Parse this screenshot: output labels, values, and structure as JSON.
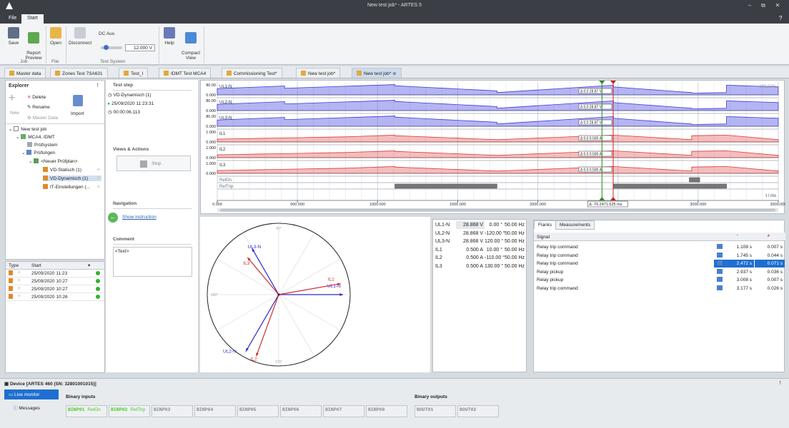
{
  "window": {
    "title": "New test job* - ARTES 5",
    "controls": [
      "–",
      "⧉",
      "✕"
    ]
  },
  "menu": {
    "file": "File",
    "start": "Start"
  },
  "ribbon": {
    "save": "Save",
    "report_preview": "Report\nPreview",
    "open": "Open",
    "disconnect": "Disconnect",
    "dc_aux": "DC Aux.",
    "dc_value": "12.000 V",
    "help": "Help",
    "compact_view": "Compact\nView",
    "group_job": "Job",
    "group_file": "File",
    "group_test_system": "Test System"
  },
  "doc_tabs": [
    "Master data",
    "Zones Test 7SA631",
    "Test_I",
    "IDMT Test MCA4",
    "Commissioning Test*",
    "New test job*",
    "New test job*"
  ],
  "explorer": {
    "title": "Explorer",
    "actions": {
      "new": "New",
      "delete": "Delete",
      "rename": "Rename",
      "import": "Import",
      "master_data": "Master Data"
    },
    "tree": [
      "New test job",
      "MCA4, IDMT",
      "Prüfsystem",
      "Prüfungen",
      "<Neuer Prüfplan>",
      "VD-Statisch (1)",
      "VD-Dynamisch (1)",
      "IT-Einstellungen (..."
    ]
  },
  "history": {
    "col_type": "Type",
    "col_start": "Start",
    "rows": [
      "25/09/2020 11:23",
      "25/09/2020 10:27",
      "25/09/2020 10:27",
      "25/09/2020 10:26"
    ]
  },
  "test_step": {
    "title": "Test step",
    "name": "VD-Dynamisch (1)",
    "date": "25/09/2020 11:23:31",
    "duration": "00:00:06.113",
    "views_title": "Views & Actions",
    "stop": "Stop",
    "nav_title": "Navigation",
    "show_instruction": "Show instruction",
    "comment_title": "Comment",
    "comment": "<Text>"
  },
  "chart_data": {
    "type": "line",
    "xlabel": "t / ms",
    "xlim": [
      0,
      3500
    ],
    "x_ticks": [
      "0.000",
      "500.000",
      "1000.000",
      "1500.000",
      "2000.000",
      "2500.000",
      "3000.000",
      "3500.000"
    ],
    "zoom": "100.00%",
    "cursor_readout": "Δ -70.2471.625 ms",
    "channels": [
      {
        "name": "UL1-N",
        "max": "80.00",
        "min": "0.000",
        "readout": "Δ 0.0 28.87 V",
        "color": "#3a3ad8"
      },
      {
        "name": "UL2-N",
        "max": "80.00",
        "min": "0.000",
        "readout": "Δ 0.0 28.87 V",
        "color": "#3a3ad8"
      },
      {
        "name": "UL3-N",
        "max": "80.00",
        "min": "0.000",
        "readout": "Δ 0.0 28.87 V",
        "color": "#3a3ad8"
      },
      {
        "name": "IL1",
        "max": "1.000",
        "min": "0.000",
        "readout": "Δ 0.0 0.500 A",
        "color": "#d83a3a"
      },
      {
        "name": "IL2",
        "max": "1.000",
        "min": "0.000",
        "readout": "Δ 0.0 0.500 A",
        "color": "#d83a3a"
      },
      {
        "name": "IL3",
        "max": "1.000",
        "min": "0.000",
        "readout": "Δ 0.0 0.500 A",
        "color": "#d83a3a"
      }
    ],
    "binary_channels": [
      {
        "name": "RelOn",
        "on": [
          [
            2945,
            3010
          ]
        ]
      },
      {
        "name": "RelTrip",
        "on": [
          [
            1108,
            1745
          ],
          [
            2472,
            3177
          ]
        ]
      }
    ]
  },
  "phasors": {
    "rows": [
      {
        "name": "UL1-N",
        "mag": "28.868 V",
        "ang": "0.00 °",
        "freq": "50.00 Hz"
      },
      {
        "name": "UL2-N",
        "mag": "28.868 V",
        "ang": "-120.00 °",
        "freq": "50.00 Hz"
      },
      {
        "name": "UL3-N",
        "mag": "28.868 V",
        "ang": "120.00 °",
        "freq": "50.00 Hz"
      },
      {
        "name": "IL1",
        "mag": "0.500 A",
        "ang": "10.00 °",
        "freq": "50.00 Hz"
      },
      {
        "name": "IL2",
        "mag": "0.500 A",
        "ang": "-110.00 °",
        "freq": "50.00 Hz"
      },
      {
        "name": "IL3",
        "mag": "0.500 A",
        "ang": "130.00 °",
        "freq": "50.00 Hz"
      }
    ],
    "angle_labels": [
      "90°",
      "180°",
      "270°"
    ],
    "vector_labels": {
      "ul1": "UL1-N",
      "ul2": "UL2-N",
      "ul3": "UL3-N",
      "il1": "IL1",
      "il2": "IL2",
      "il3": "IL3"
    }
  },
  "flanks": {
    "tab_flanks": "Flanks",
    "tab_measurements": "Measurements",
    "col_signal": "Signal",
    "rows": [
      {
        "signal": "Relay trip command",
        "t": "1.108 s",
        "d": "0.007 s"
      },
      {
        "signal": "Relay trip command",
        "t": "1.745 s",
        "d": "0.044 s"
      },
      {
        "signal": "Relay trip command",
        "t": "2.472 s",
        "d": "0.071 s"
      },
      {
        "signal": "Relay pickup",
        "t": "2.937 s",
        "d": "0.036 s"
      },
      {
        "signal": "Relay pickup",
        "t": "3.008 s",
        "d": "0.007 s"
      },
      {
        "signal": "Relay trip command",
        "t": "3.177 s",
        "d": "0.026 s"
      }
    ]
  },
  "device": {
    "title": "Device [ARTES 460 (SN: 32801001015)]",
    "live_monitor": "Live monitor",
    "messages": "Messages",
    "binary_inputs": "Binary inputs",
    "binary_outputs": "Binary outputs",
    "inputs": [
      {
        "id": "BINP01",
        "label": "RelOn"
      },
      {
        "id": "BINP02",
        "label": "RelTrip"
      },
      {
        "id": "BINP03",
        "label": ""
      },
      {
        "id": "BINP04",
        "label": ""
      },
      {
        "id": "BINP05",
        "label": ""
      },
      {
        "id": "BINP06",
        "label": ""
      },
      {
        "id": "BINP07",
        "label": ""
      },
      {
        "id": "BINP08",
        "label": ""
      }
    ],
    "outputs": [
      {
        "id": "BOUT01"
      },
      {
        "id": "BOUT02"
      }
    ]
  }
}
